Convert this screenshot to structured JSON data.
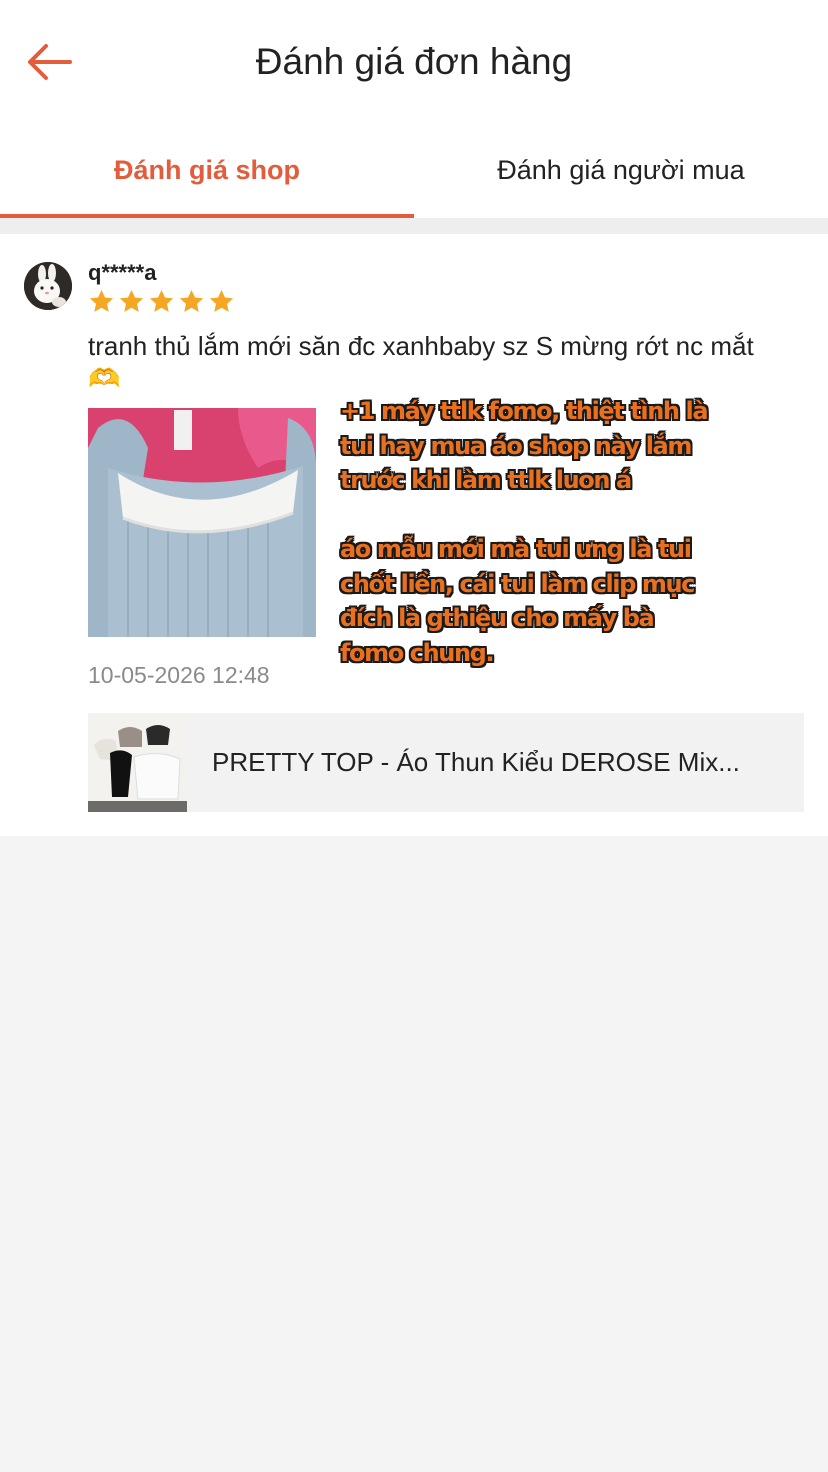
{
  "header": {
    "title": "Đánh giá đơn hàng",
    "back_icon": "arrow-left-icon",
    "accent_color": "#e35c3c"
  },
  "tabs": [
    {
      "label": "Đánh giá shop",
      "active": true
    },
    {
      "label": "Đánh giá người mua",
      "active": false
    }
  ],
  "review": {
    "username": "q*****a",
    "rating": 5,
    "rating_max": 5,
    "text": "tranh thủ lắm mới săn đc xanhbaby sz S mừng rớt nc mắt 🫶",
    "timestamp": "10-05-2026 12:48",
    "overlay_lines": [
      "+1 máy ttlk fomo, thiệt tình là",
      "tui hay mua áo shop này lắm",
      "trước khi làm ttlk luon á",
      "áo mẫu mới mà tui ưng là tui",
      "chốt liền, cái tui làm clip mục",
      "đích là gthiệu cho mấy bà",
      "fomo chung."
    ]
  },
  "product": {
    "name": "PRETTY TOP - Áo Thun Kiểu DEROSE Mix..."
  }
}
